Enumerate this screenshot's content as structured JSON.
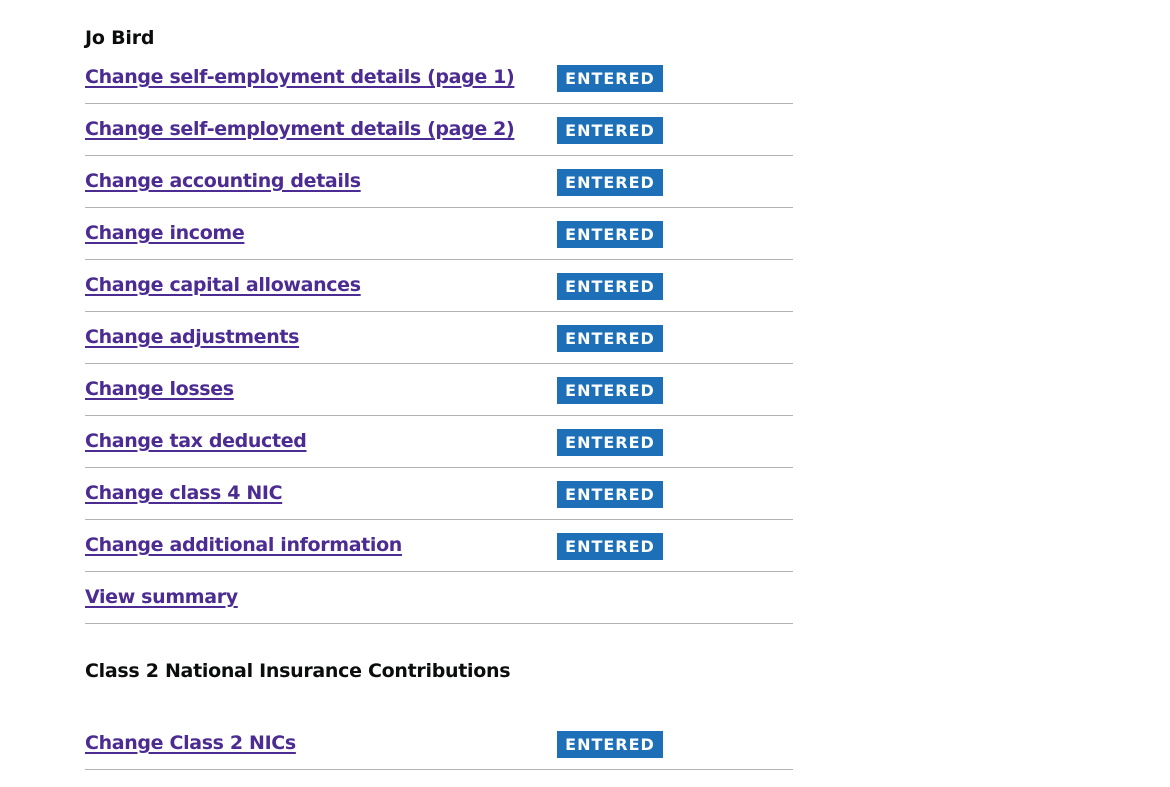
{
  "person_section": {
    "heading": "Jo Bird",
    "tasks": [
      {
        "label": "Change self-employment details (page 1)",
        "status": "ENTERED"
      },
      {
        "label": "Change self-employment details (page 2)",
        "status": "ENTERED"
      },
      {
        "label": "Change accounting details",
        "status": "ENTERED"
      },
      {
        "label": "Change income",
        "status": "ENTERED"
      },
      {
        "label": "Change capital allowances",
        "status": "ENTERED"
      },
      {
        "label": "Change adjustments",
        "status": "ENTERED"
      },
      {
        "label": "Change losses",
        "status": "ENTERED"
      },
      {
        "label": "Change tax deducted",
        "status": "ENTERED"
      },
      {
        "label": "Change class 4 NIC",
        "status": "ENTERED"
      },
      {
        "label": "Change additional information",
        "status": "ENTERED"
      },
      {
        "label": "View summary",
        "status": ""
      }
    ]
  },
  "class2_section": {
    "heading": "Class 2 National Insurance Contributions",
    "tasks": [
      {
        "label": "Change Class 2 NICs",
        "status": "ENTERED"
      }
    ]
  },
  "colors": {
    "link": "#4c2c92",
    "tag_background": "#1d70b8",
    "tag_text": "#ffffff",
    "divider": "#b1b4b6",
    "text": "#0b0c0c"
  }
}
